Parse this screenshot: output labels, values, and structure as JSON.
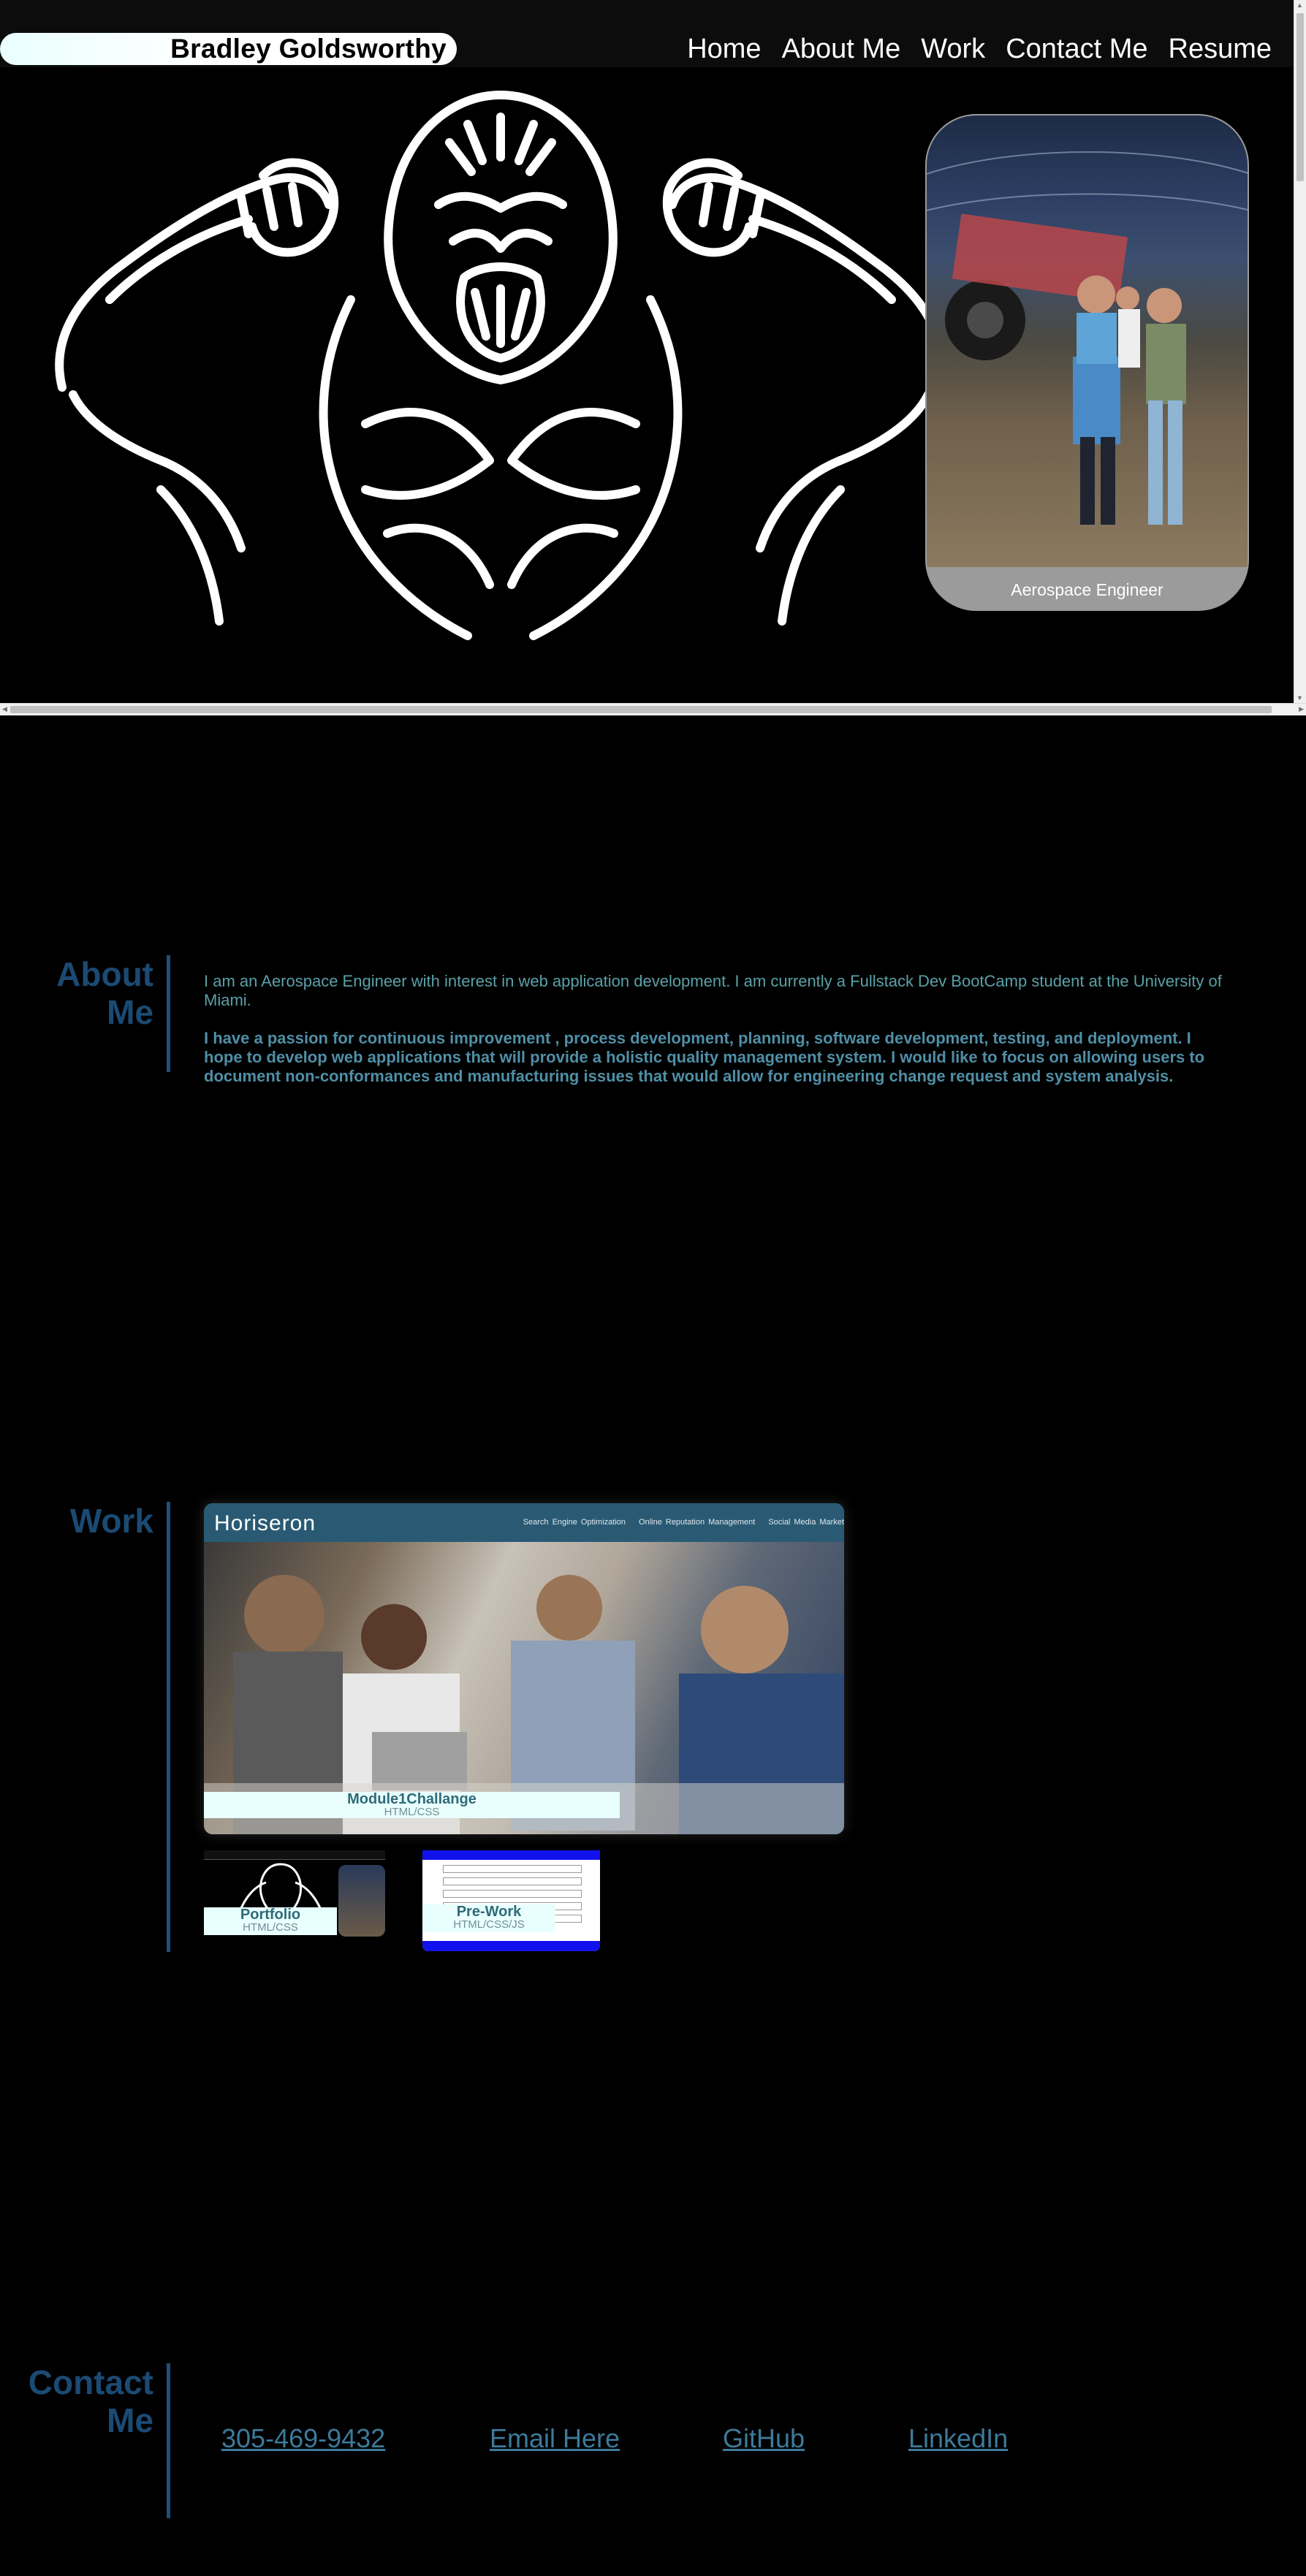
{
  "header": {
    "name": "Bradley Goldsworthy",
    "nav": [
      "Home",
      "About Me",
      "Work",
      "Contact Me",
      "Resume"
    ]
  },
  "hero": {
    "art_icon": "gorilla-flexing-icon",
    "profile_caption": "Aerospace Engineer"
  },
  "about": {
    "heading_line1": "About",
    "heading_line2": "Me",
    "paragraph1": "I am an Aerospace Engineer with interest in web application development. I am currently a Fullstack Dev BootCamp student at the University of Miami.",
    "paragraph2": "I have a passion for continuous improvement , process development, planning, software development, testing, and deployment. I hope to develop web applications that will provide a holistic quality management system. I would like to focus on allowing users to document non-conformances and manufacturing issues that would allow for engineering change request and system analysis."
  },
  "work": {
    "heading": "Work",
    "featured": {
      "logo": "Horiseron",
      "links": [
        "Search Engine Optimization",
        "Online Reputation Management",
        "Social Media Market"
      ],
      "title": "Module1Challange",
      "tech": "HTML/CSS"
    },
    "projects": [
      {
        "title": "Portfolio",
        "tech": "HTML/CSS"
      },
      {
        "title": "Pre-Work",
        "tech": "HTML/CSS/JS"
      }
    ]
  },
  "contact": {
    "heading_line1": "Contact",
    "heading_line2": "Me",
    "links": [
      "305-469-9432",
      "Email Here",
      "GitHub",
      "LinkedIn"
    ]
  },
  "colors": {
    "heading_blue": "#1b4a73",
    "text_teal": "#5aa0a8",
    "label_bg": "#e9fffe"
  }
}
